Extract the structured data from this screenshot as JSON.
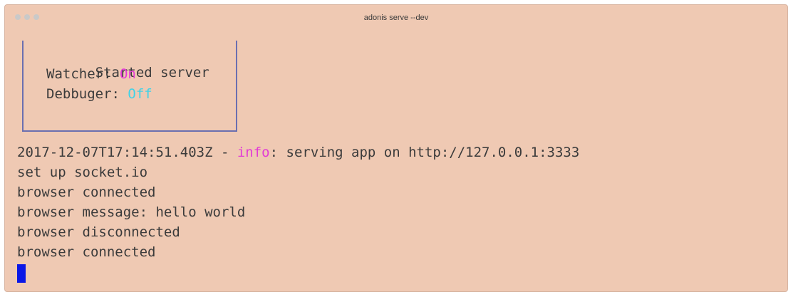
{
  "window": {
    "title": "adonis serve --dev"
  },
  "status_box": {
    "line1": "Started server",
    "watcher_label": "Watcher: ",
    "watcher_value": "On",
    "debugger_label": "Debbuger: ",
    "debugger_value": "Off"
  },
  "log": {
    "first_prefix": "2017-12-07T17:14:51.403Z - ",
    "first_level": "info",
    "first_message": ": serving app on http://127.0.0.1:3333",
    "lines": [
      "set up socket.io",
      "browser connected",
      "browser message: hello world",
      "browser disconnected",
      "browser connected"
    ]
  },
  "colors": {
    "background": "#efc9b3",
    "text": "#3b3b3b",
    "accent_magenta": "#e23bd5",
    "accent_cyan": "#3fd3e8",
    "box_border": "#6a6fb0",
    "cursor": "#0a17e6"
  }
}
